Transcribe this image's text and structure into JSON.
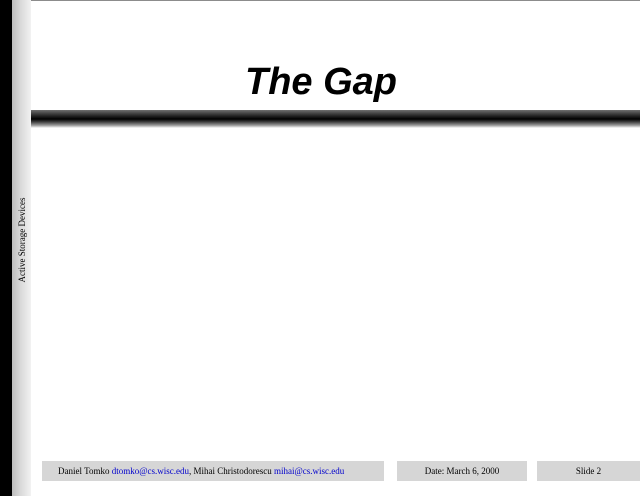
{
  "slide": {
    "title": "The Gap",
    "side_label": "Active Storage Devices"
  },
  "footer": {
    "author1_name": "Daniel Tomko ",
    "author1_email": "dtomko@cs.wisc.edu",
    "separator": ", Mihai Christodorescu ",
    "author2_email": "mihai@cs.wisc.edu",
    "date": "Date: March 6, 2000",
    "slide_number": "Slide 2"
  },
  "colors": {
    "email_link": "#0000cc",
    "footer_background": "#d6d6d6",
    "left_bar": "#d9d9d9"
  }
}
